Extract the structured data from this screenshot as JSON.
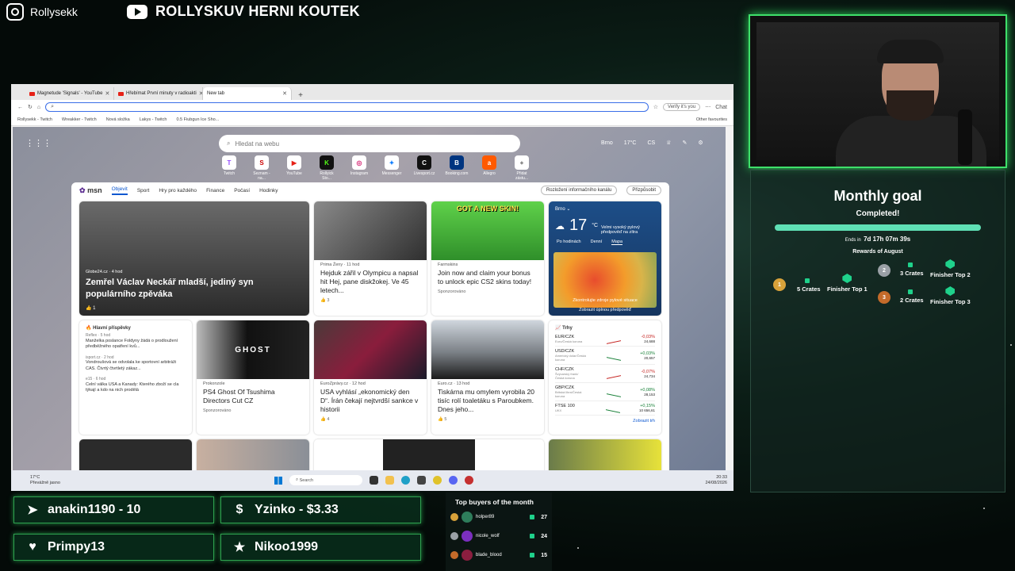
{
  "overlay": {
    "instagram_handle": "Rollysekk",
    "youtube_channel": "ROLLYSKUV HERNI KOUTEK"
  },
  "browser": {
    "tabs": [
      {
        "label": "Magnetude 'Signals' - YouTube"
      },
      {
        "label": "Hřebímat První minuty v radioakti"
      },
      {
        "label": "New tab"
      }
    ],
    "verify_label": "Verify it's you",
    "chat_label": "Chat",
    "bookmarks": [
      "Rollysekk - Twitch",
      "Wreakker - Twitch",
      "Nová složka",
      "Lakys - Twitch",
      "0.5 Fiubgun Ice Sho..."
    ],
    "other_favourites": "Other favourites"
  },
  "newtab": {
    "search_placeholder": "Hledat na webu",
    "weather_city": "Brno",
    "weather_temp": "17°C",
    "region": "CS",
    "quick_links": [
      "Twitch",
      "Seznam - na...",
      "YouTube",
      "Rollyick Sto...",
      "Instagram",
      "Messenger",
      "Livesport.cz",
      "Booking.com",
      "Allegro",
      "Přidat zástu..."
    ],
    "nav": {
      "brand": "msn",
      "items": [
        "Objevit",
        "Sport",
        "Hry pro každého",
        "Finance",
        "Počasí",
        "Hodinky"
      ],
      "layout_button": "Rozložení informačního kanálu",
      "customize_button": "Přizpůsobit"
    }
  },
  "feed": {
    "hero": {
      "source": "Globe24.cz · 4 hod",
      "title": "Zemřel Václav Neckář mladší, jediný syn populárního zpěváka",
      "likes": "1"
    },
    "card2": {
      "source": "Prima Ženy · 11 hod",
      "title": "Hejduk zářil v Olympicu a napsal hit Hej, pane diskžokej. Ve 45 letech...",
      "likes": "3"
    },
    "card3": {
      "source": "Farmskins",
      "title": "Join now and claim your bonus to unlock epic CS2 skins today!",
      "banner": "GOT A NEW SKIN!",
      "sponsored": "Sponzorováno"
    },
    "weather": {
      "city": "Brno",
      "temp": "17",
      "unit": "°C",
      "desc": "Velmi vysoký pylový předpověď na zítra",
      "tabs": [
        "Po hodinách",
        "Denní",
        "Mapa"
      ],
      "note": "Zkontrolujte zdroje pylové situace",
      "link": "Zobrazit úplnou předpověď"
    },
    "list": {
      "header": "Hlavní příspěvky",
      "items": [
        {
          "source": "Reflex · 5 hod",
          "text": "Manželka poslance Foldyny žádá o prodloužení předběžného opatření kvů..."
        },
        {
          "source": "isport.cz · 2 hod",
          "text": "Vondroušová se odvolala ke sportovní arbitráži CAS. Čtvrtý čtvrtletý zákaz..."
        },
        {
          "source": "e15 · 6 hod",
          "text": "Celní válka USA a Kanady: Kterého zboží se cla týkají a kdo na nich prodělá"
        }
      ]
    },
    "card5": {
      "source": "Prokonzole",
      "title": "PS4 Ghost Of Tsushima Directors Cut CZ",
      "sponsored": "Sponzorováno",
      "cover_title": "GHOST"
    },
    "card6": {
      "source": "EuroZprávy.cz · 12 hod",
      "title": "USA vyhlásí „ekonomický den D“. Írán čekají nejtvrdší sankce v historii",
      "likes": "4"
    },
    "card7": {
      "source": "Euro.cz · 13 hod",
      "title": "Tiskárna mu omylem vyrobila 20 tisíc rolí toaletáku s Paroubkem. Dnes jeho...",
      "likes": "5"
    },
    "markets": {
      "header": "Trhy",
      "rows": [
        {
          "name": "EUR/CZK",
          "sub": "Euro/Česká koruna",
          "change": "-0,03%",
          "value": "24,688",
          "up": false
        },
        {
          "name": "USD/CZK",
          "sub": "Americký dolar/Česká koruna",
          "change": "+0,03%",
          "value": "20,657",
          "up": true
        },
        {
          "name": "CHF/CZK",
          "sub": "Švýcarský frank/Česká koruna",
          "change": "-0,07%",
          "value": "24,734",
          "up": false
        },
        {
          "name": "GBP/CZK",
          "sub": "Britská libra/Česká koruna",
          "change": "+0,08%",
          "value": "28,153",
          "up": true
        },
        {
          "name": "FTSE 100",
          "sub": "UKX",
          "change": "+0,15%",
          "value": "10 656,61",
          "up": true
        }
      ],
      "link": "Zobrazit trh"
    }
  },
  "taskbar": {
    "weather_temp": "17°C",
    "weather_desc": "Převážně jasno",
    "search": "Search",
    "time": "20:33",
    "date": "24/08/2026"
  },
  "goal": {
    "title": "Monthly goal",
    "status": "Completed!",
    "progress_fraction": 1.0,
    "ends_label": "Ends in",
    "ends_value": "7d 17h 07m 39s",
    "rewards_title": "Rewards of August",
    "rewards": [
      {
        "rank": "1",
        "crates": "5 Crates",
        "finisher": "Finisher Top 1"
      },
      {
        "rank": "2",
        "crates": "3 Crates",
        "finisher": "Finisher Top 2"
      },
      {
        "rank": "3",
        "crates": "2 Crates",
        "finisher": "Finisher Top 3"
      }
    ]
  },
  "alerts": [
    {
      "icon": "cursor-icon",
      "text": "anakin1190 - 10"
    },
    {
      "icon": "dollar-icon",
      "text": "Yzinko - $3.33"
    },
    {
      "icon": "heart-icon",
      "text": "Primpy13"
    },
    {
      "icon": "star-icon",
      "text": "Nikoo1999"
    }
  ],
  "buyers": {
    "title": "Top buyers of the month",
    "rows": [
      {
        "name": "holper89",
        "value": "27"
      },
      {
        "name": "nicole_wolf",
        "value": "24"
      },
      {
        "name": "blade_blood",
        "value": "15"
      }
    ]
  },
  "colors": {
    "accent_green": "#3ee06a",
    "progress": "#5fe0b5",
    "link_blue": "#0b57d0"
  }
}
